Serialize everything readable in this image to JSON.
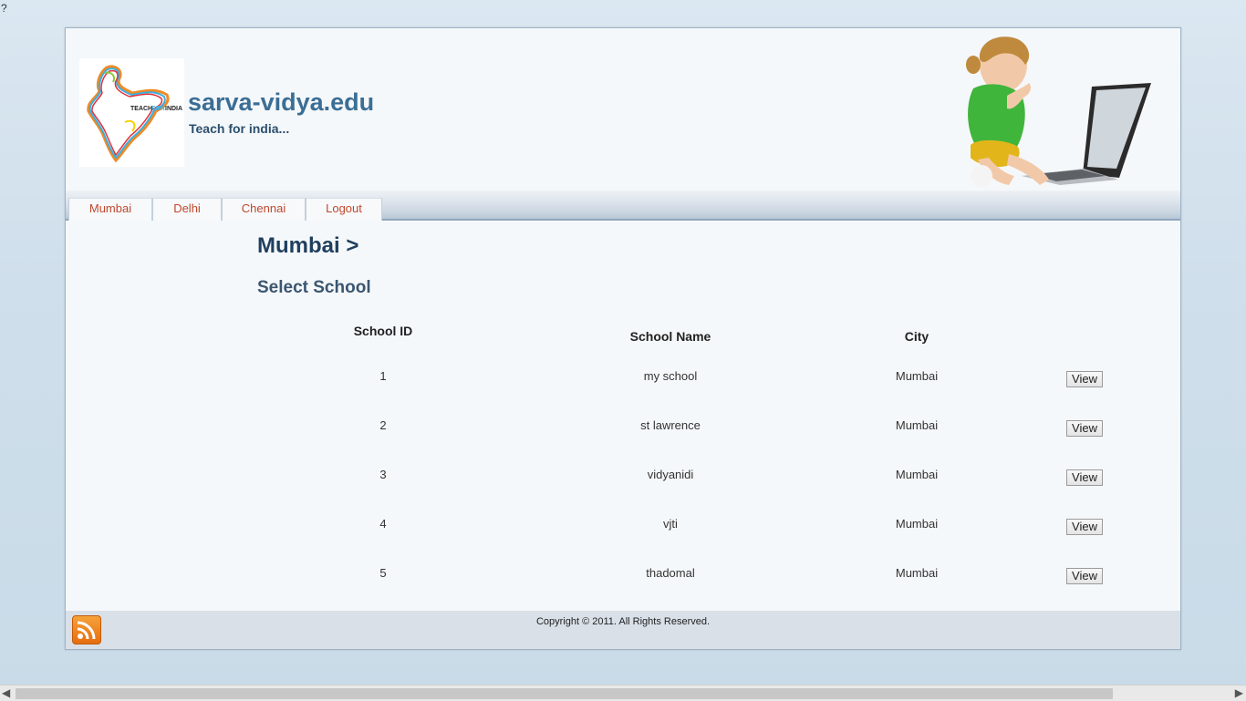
{
  "misc": {
    "question_mark": "?"
  },
  "site": {
    "title": "sarva-vidya.edu",
    "tagline": "Teach for india..."
  },
  "logo": {
    "text_teach": "TEACH",
    "text_for": "FOR",
    "text_india": "INDIA"
  },
  "nav": {
    "tabs": [
      "Mumbai",
      "Delhi",
      "Chennai",
      "Logout"
    ]
  },
  "main": {
    "city_heading": "Mumbai >",
    "subheading": "Select School",
    "columns": [
      "School ID",
      "School Name",
      "City"
    ],
    "rows": [
      {
        "id": "1",
        "name": "my school",
        "city": "Mumbai",
        "action": "View"
      },
      {
        "id": "2",
        "name": "st lawrence",
        "city": "Mumbai",
        "action": "View"
      },
      {
        "id": "3",
        "name": "vidyanidi",
        "city": "Mumbai",
        "action": "View"
      },
      {
        "id": "4",
        "name": "vjti",
        "city": "Mumbai",
        "action": "View"
      },
      {
        "id": "5",
        "name": "thadomal",
        "city": "Mumbai",
        "action": "View"
      }
    ]
  },
  "footer": {
    "copyright": "Copyright © 2011. All Rights Reserved.",
    "rss_icon": "rss-icon"
  },
  "colors": {
    "accent": "#c0482c",
    "title": "#3b6e95",
    "heading": "#1f3f5f"
  }
}
